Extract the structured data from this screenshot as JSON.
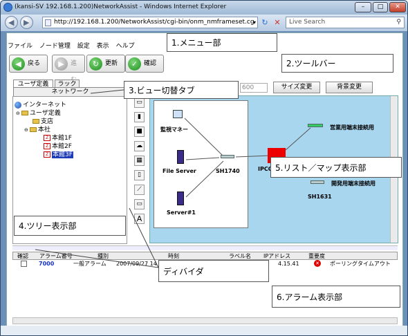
{
  "window": {
    "title": "(kansi-SV 192.168.1.200)NetworkAssist - Windows Internet Explorer",
    "min": "–",
    "max": "□",
    "close": "✕"
  },
  "address": {
    "url": "http://192.168.1.200/NetworkAssist/cgi-bin/onm_nmframeset.cg",
    "search_placeholder": "Live Search"
  },
  "menu": [
    "ファイル",
    "ノード管理",
    "設定",
    "表示",
    "ヘルプ"
  ],
  "toolbar": {
    "back": "戻る",
    "forward": "進む",
    "refresh": "更新",
    "confirm": "確認"
  },
  "callouts": {
    "menu": "1.メニュー部",
    "toolbar": "2.ツールバー",
    "viewtab": "3.ビュー切替タブ",
    "tree": "4.ツリー表示部",
    "map": "5.リスト／マップ表示部",
    "alarm": "6.アラーム表示部",
    "divider": "ディバイダ"
  },
  "tabs": {
    "user": "ユーザ定義",
    "rack": "ラック",
    "network": "ネットワーク"
  },
  "tree": {
    "root": "インターネット",
    "user": "ユーザ定義",
    "branch": "支店",
    "hq": "本社",
    "f1": "本館1F",
    "f2": "本館2F",
    "f3": "本館3F"
  },
  "map": {
    "size_value": "600",
    "size_button": "サイズ変更",
    "bg_button": "背景変更",
    "nodes": {
      "monitor": "監視マネー",
      "fileserver": "File Server",
      "sh1740": "SH1740",
      "server1": "Server#1",
      "ipc": "IPCO",
      "sales": "営業用端末接続用",
      "dev": "開発用端末接続用",
      "sh1631": "SH1631"
    }
  },
  "alarm": {
    "headers": [
      "確認",
      "アラーム番号",
      "種別",
      "時刻",
      "ラベル名",
      "IPアドレス",
      "重要度"
    ],
    "row": {
      "number": "7000",
      "type": "一般アラーム",
      "time": "2007/09/27 14",
      "ip": "4.15.41",
      "severity_icon": "error-icon",
      "message": "ポーリングタイムアウト"
    }
  }
}
